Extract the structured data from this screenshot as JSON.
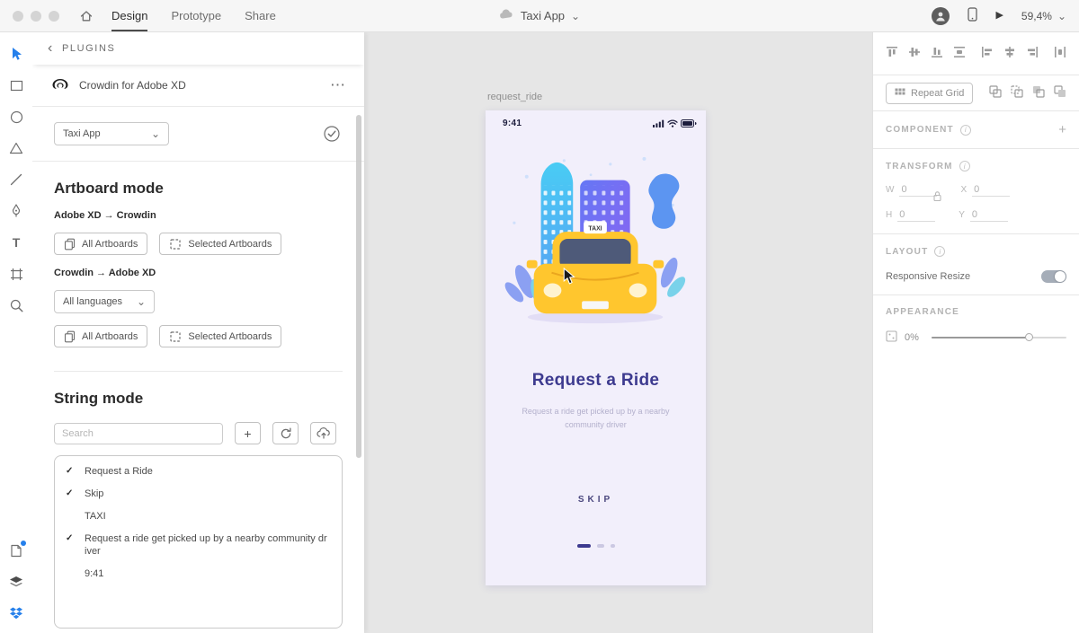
{
  "colors": {
    "accent": "#2680eb",
    "indigo": "#3d3a8f",
    "taxi_yellow": "#ffc62e",
    "artboard_bg": "#f2effb",
    "canvas_bg": "#e6e6e6"
  },
  "icons": {
    "chevron_left": "‹",
    "chevron_down": "⌄",
    "ellipsis": "⋯",
    "check": "✓",
    "plus": "+",
    "info": "i",
    "play": "▶",
    "text_tool": "T"
  },
  "topbar": {
    "tabs": [
      {
        "label": "Design",
        "active": true
      },
      {
        "label": "Prototype",
        "active": false
      },
      {
        "label": "Share",
        "active": false
      }
    ],
    "document_title": "Taxi App",
    "zoom_level": "59,4%"
  },
  "plugin_panel": {
    "header": "PLUGINS",
    "plugin_title": "Crowdin for Adobe XD",
    "project_select_value": "Taxi App",
    "artboard_mode": {
      "heading": "Artboard mode",
      "direction_xd_to_crowdin": "Adobe XD → Crowdin",
      "direction_crowdin_to_xd": "Crowdin → Adobe XD",
      "all_artboards_label": "All Artboards",
      "selected_artboards_label": "Selected Artboards",
      "languages_select_value": "All languages"
    },
    "string_mode": {
      "heading": "String mode",
      "search_placeholder": "Search",
      "strings": [
        {
          "checked": true,
          "text": "Request a Ride"
        },
        {
          "checked": true,
          "text": "Skip"
        },
        {
          "checked": false,
          "text": "TAXI"
        },
        {
          "checked": true,
          "text": "Request a ride get picked up by a nearby community driver"
        },
        {
          "checked": false,
          "text": "9:41"
        }
      ]
    }
  },
  "canvas": {
    "artboard_label": "request_ride",
    "artboard": {
      "status_time": "9:41",
      "title": "Request a Ride",
      "subtitle": "Request a ride get picked up by a nearby community driver",
      "skip_label": "SKIP",
      "taxi_sign": "TAXI"
    }
  },
  "right_panel": {
    "repeat_grid_label": "Repeat Grid",
    "component_heading": "COMPONENT",
    "transform_heading": "TRANSFORM",
    "transform": {
      "w_label": "W",
      "w_value": "0",
      "x_label": "X",
      "x_value": "0",
      "h_label": "H",
      "h_value": "0",
      "y_label": "Y",
      "y_value": "0"
    },
    "layout_heading": "LAYOUT",
    "responsive_resize_label": "Responsive Resize",
    "responsive_resize_on": true,
    "appearance_heading": "APPEARANCE",
    "opacity_value": "0%"
  }
}
